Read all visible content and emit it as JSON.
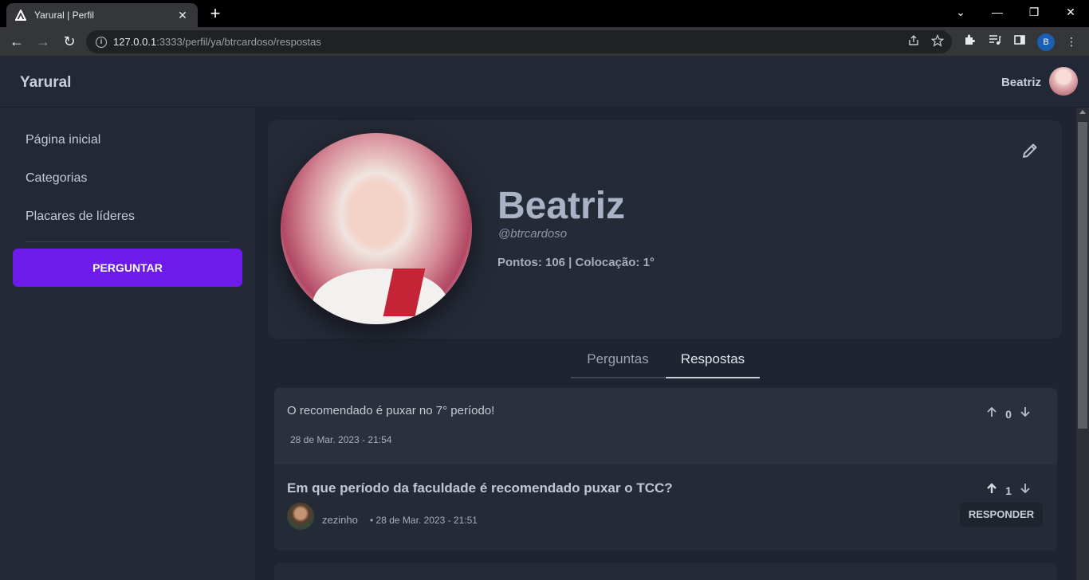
{
  "browser": {
    "tab_title": "Yarural | Perfil",
    "tab_close": "✕",
    "new_tab": "+",
    "url_host": "127.0.0.1",
    "url_path": ":3333/perfil/ya/btrcardoso/respostas",
    "profile_initial": "B",
    "window_controls": {
      "dropdown": "⌄",
      "minimize": "—",
      "restore": "❐",
      "close": "✕"
    },
    "nav": {
      "back": "←",
      "forward": "→",
      "reload": "↻"
    }
  },
  "header": {
    "brand": "Yarural",
    "user_name": "Beatriz"
  },
  "sidebar": {
    "items": [
      {
        "label": "Página inicial"
      },
      {
        "label": "Categorias"
      },
      {
        "label": "Placares de líderes"
      }
    ],
    "ask_button": "PERGUNTAR"
  },
  "profile": {
    "name": "Beatriz",
    "handle": "@btrcardoso",
    "stats": "Pontos: 106 | Colocação: 1°"
  },
  "tabs": [
    {
      "label": "Perguntas",
      "active": false
    },
    {
      "label": "Respostas",
      "active": true
    }
  ],
  "answer": {
    "text": "O recomendado é puxar no 7° período!",
    "date": "28 de Mar. 2023 - 21:54",
    "votes": "0"
  },
  "question": {
    "title": "Em que período da faculdade é recomendado puxar o TCC?",
    "author": "zezinho",
    "date": "• 28 de Mar. 2023 - 21:51",
    "votes": "1",
    "reply_button": "RESPONDER"
  },
  "colors": {
    "accent": "#6d1aea",
    "background": "#1f2430",
    "panel": "#232836"
  }
}
